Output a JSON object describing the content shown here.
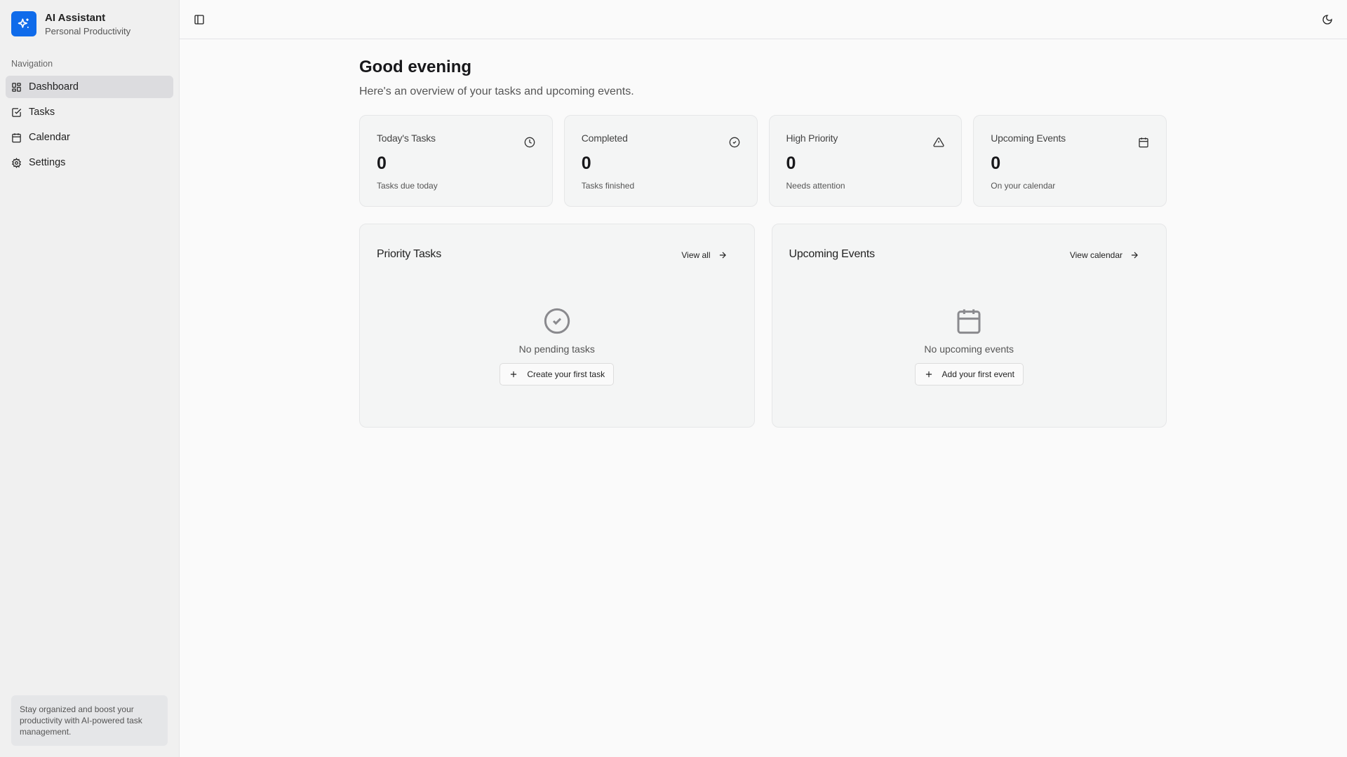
{
  "sidebar": {
    "app_title": "AI Assistant",
    "app_subtitle": "Personal Productivity",
    "nav_label": "Navigation",
    "items": [
      {
        "label": "Dashboard",
        "icon": "dashboard-icon"
      },
      {
        "label": "Tasks",
        "icon": "check-square-icon"
      },
      {
        "label": "Calendar",
        "icon": "calendar-icon"
      },
      {
        "label": "Settings",
        "icon": "gear-icon"
      }
    ],
    "tip": "Stay organized and boost your productivity with AI-powered task management."
  },
  "header": {
    "toggle_icon": "sidebar-toggle-icon",
    "theme_icon": "moon-icon"
  },
  "main": {
    "greeting": "Good evening",
    "subtitle": "Here's an overview of your tasks and upcoming events.",
    "stats": [
      {
        "title": "Today's Tasks",
        "value": "0",
        "sub": "Tasks due today",
        "icon": "clock-icon"
      },
      {
        "title": "Completed",
        "value": "0",
        "sub": "Tasks finished",
        "icon": "check-circle-icon"
      },
      {
        "title": "High Priority",
        "value": "0",
        "sub": "Needs attention",
        "icon": "alert-triangle-icon"
      },
      {
        "title": "Upcoming Events",
        "value": "0",
        "sub": "On your calendar",
        "icon": "calendar-icon"
      }
    ],
    "priority": {
      "title": "Priority Tasks",
      "link": "View all",
      "empty": "No pending tasks",
      "button": "Create your first task"
    },
    "events": {
      "title": "Upcoming Events",
      "link": "View calendar",
      "empty": "No upcoming events",
      "button": "Add your first event"
    }
  },
  "colors": {
    "accent": "#0f6bea"
  }
}
